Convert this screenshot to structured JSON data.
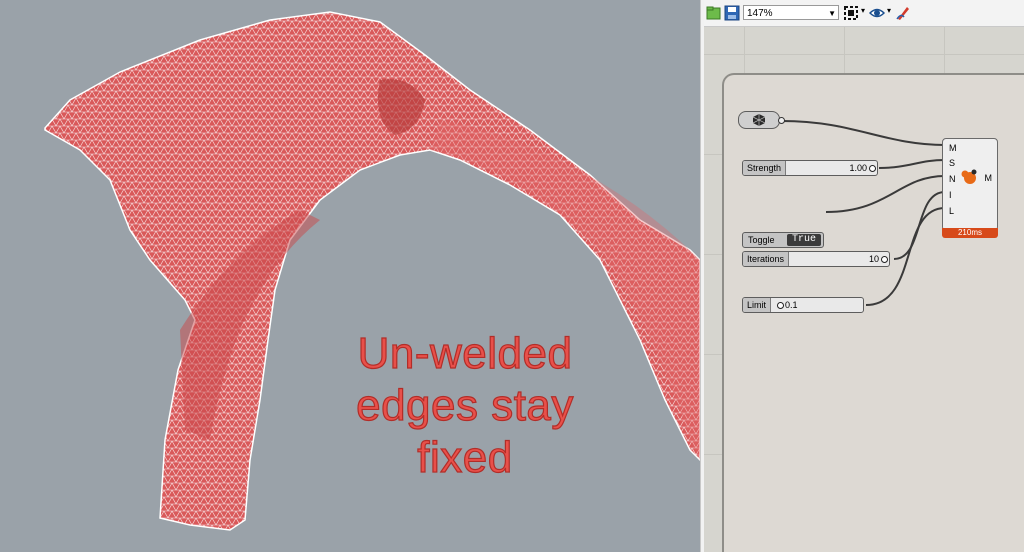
{
  "caption": {
    "line1": "Un-welded",
    "line2": "edges stay",
    "line3": "fixed"
  },
  "toolbar": {
    "zoom_value": "147%"
  },
  "components": {
    "strength": {
      "label": "Strength",
      "value": "1.00"
    },
    "toggle": {
      "label": "Toggle",
      "value": "True"
    },
    "iterations": {
      "label": "Iterations",
      "value": "10"
    },
    "limit": {
      "label": "Limit",
      "value": "0.1"
    }
  },
  "kangaroo": {
    "inputs": [
      "M",
      "S",
      "N",
      "I",
      "L"
    ],
    "output": "M",
    "time": "210ms"
  },
  "colors": {
    "mesh": "#d9595a",
    "caption": "#e8504a",
    "timer": "#d74a1a"
  }
}
